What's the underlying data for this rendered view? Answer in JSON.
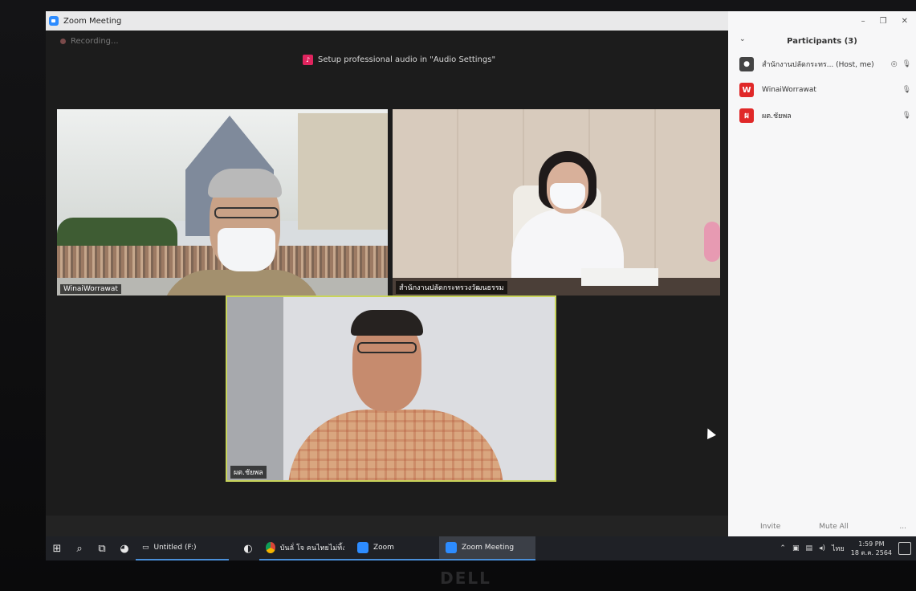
{
  "window": {
    "title": "Zoom Meeting"
  },
  "meeting": {
    "recording_label": "Recording...",
    "audio_notice": "Setup professional audio in \"Audio Settings\""
  },
  "tiles": [
    {
      "label": "WinaiWorrawat"
    },
    {
      "label": "สำนักงานปลัดกระทรวงวัฒนธรรม"
    },
    {
      "label": "ผต.ชัยพล"
    }
  ],
  "participants_panel": {
    "title": "Participants (3)",
    "participants": [
      {
        "avatar_letter": "",
        "name": "สำนักงานปลัดกระทร... (Host, me)",
        "avatar_color": "#444444"
      },
      {
        "avatar_letter": "W",
        "name": "WinaiWorrawat",
        "avatar_color": "#e02828"
      },
      {
        "avatar_letter": "ผ",
        "name": "ผต.ชัยพล",
        "avatar_color": "#e02828"
      }
    ],
    "invite_label": "Invite",
    "mute_all_label": "Mute All",
    "more_label": "..."
  },
  "taskbar": {
    "apps": [
      {
        "label": "Untitled (F:)",
        "icon": "drive-icon"
      },
      {
        "label": "บันลั่ โจ คนไทยไม่ทิ้งกั...",
        "icon": "chrome-icon"
      },
      {
        "label": "Zoom",
        "icon": "zoom-icon"
      },
      {
        "label": "Zoom Meeting",
        "icon": "zoom-icon"
      }
    ],
    "language": "ไทย",
    "time": "1:59 PM",
    "date": "18 ต.ค. 2564"
  },
  "monitor_brand": "DELL",
  "colors": {
    "zoom_blue": "#2d8cff",
    "speaker_border": "#c8d45a",
    "avatar_red": "#e02828"
  }
}
